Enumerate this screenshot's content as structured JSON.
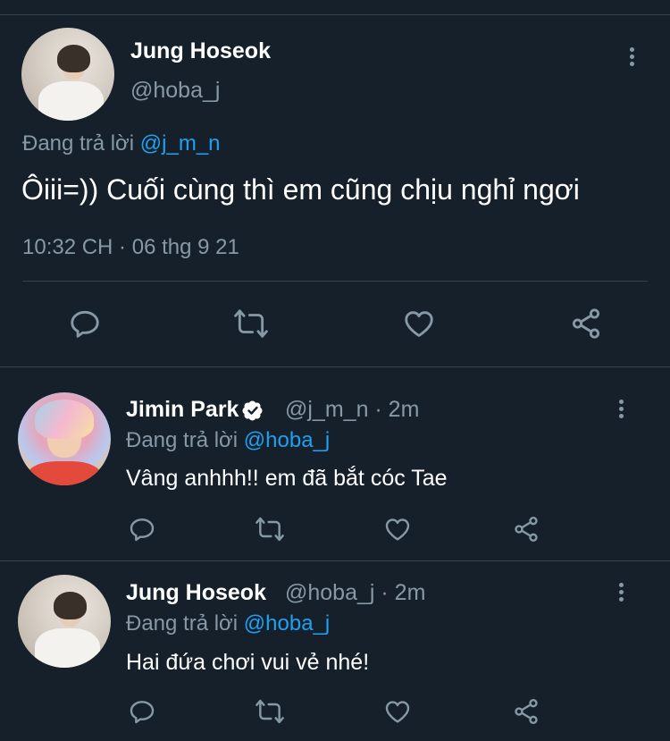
{
  "main_tweet": {
    "name": "Jung Hoseok",
    "handle": "@hoba_j",
    "reply_prefix": "Đang trả lời",
    "reply_mention": "@j_m_n",
    "text": "Ôiii=)) Cuối cùng thì em cũng chịu nghỉ ngơi",
    "timestamp": "10:32 CH · 06 thg 9 21"
  },
  "replies": [
    {
      "name": "Jimin Park",
      "verified": true,
      "handle_time": "@j_m_n · 2m",
      "reply_prefix": "Đang trả lời",
      "reply_mention": "@hoba_j",
      "text": "Vâng anhhh!! em đã bắt cóc Tae"
    },
    {
      "name": "Jung Hoseok",
      "verified": false,
      "handle_time": "@hoba_j · 2m",
      "reply_prefix": "Đang trả lời",
      "reply_mention": "@hoba_j",
      "text": "Hai đứa chơi vui vẻ nhé!"
    }
  ],
  "icons": {
    "reply": "reply-icon",
    "retweet": "retweet-icon",
    "like": "heart-icon",
    "share": "share-icon",
    "more": "more-vertical-icon",
    "verified": "verified-badge-icon"
  },
  "colors": {
    "background": "#15202b",
    "divider": "#38444d",
    "secondary_text": "#8899a6",
    "link": "#1da1f2"
  }
}
